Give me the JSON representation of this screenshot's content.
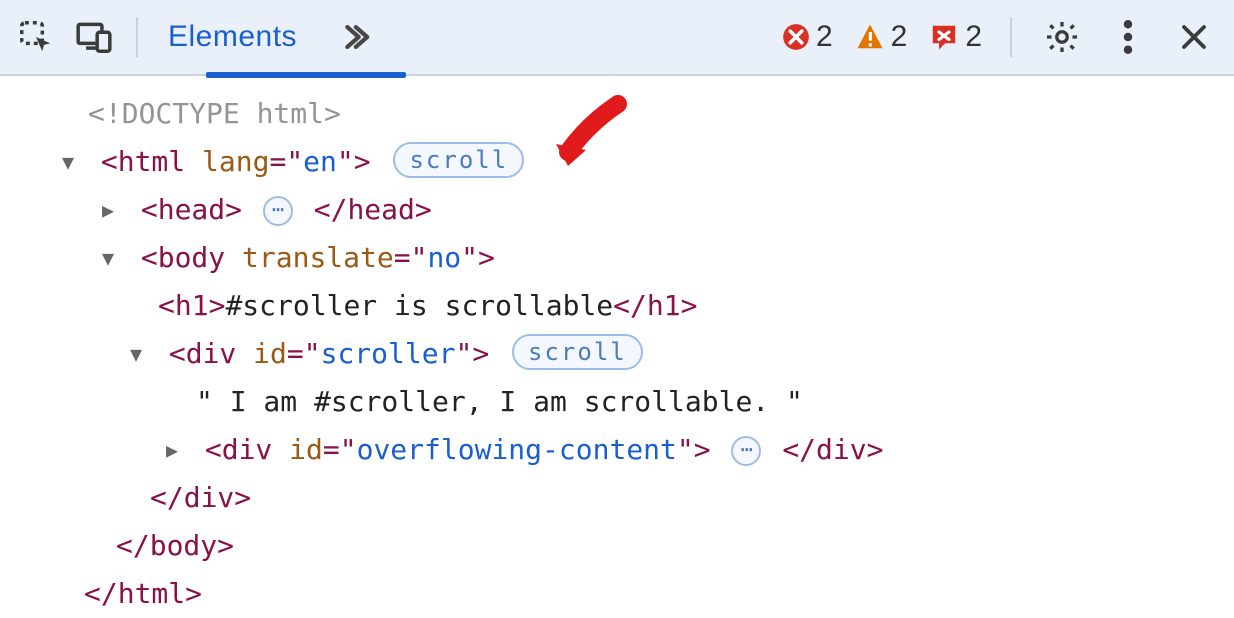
{
  "toolbar": {
    "tab_label": "Elements",
    "errors_count": "2",
    "warnings_count": "2",
    "issues_count": "2"
  },
  "badges": {
    "scroll": "scroll",
    "ellipsis": "⋯"
  },
  "dom": {
    "doctype": "<!DOCTYPE html>",
    "html_open_1": "<",
    "html_tag": "html",
    "html_attr_lang": "lang",
    "html_attr_lang_val": "en",
    "html_close_angle": ">",
    "head_open": "<",
    "head_tag": "head",
    "head_close_open": "</",
    "head_close_tag": "head",
    "body_open": "<",
    "body_tag": "body",
    "body_attr_translate": "translate",
    "body_attr_translate_val": "no",
    "h1_open": "<",
    "h1_tag": "h1",
    "h1_text": "#scroller is scrollable",
    "h1_close": "</",
    "div1_open": "<",
    "div1_tag": "div",
    "div1_attr_id": "id",
    "div1_attr_id_val": "scroller",
    "scroller_text": "\" I am #scroller, I am scrollable. \"",
    "div2_open": "<",
    "div2_tag": "div",
    "div2_attr_id": "id",
    "div2_attr_id_val": "overflowing-content",
    "div_close_open": "</",
    "div_close_tag": "div",
    "body_close_open": "</",
    "body_close_tag": "body",
    "html_close_open": "</",
    "html_close_tag": "html",
    "gt": ">",
    "eq": "=",
    "q": "\""
  }
}
